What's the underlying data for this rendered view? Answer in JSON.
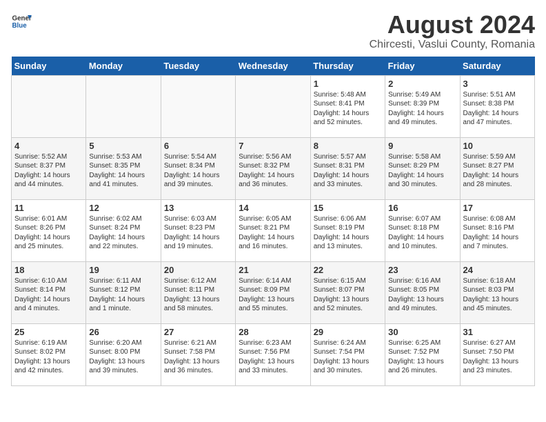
{
  "header": {
    "logo_general": "General",
    "logo_blue": "Blue",
    "title": "August 2024",
    "subtitle": "Chircesti, Vaslui County, Romania"
  },
  "days_of_week": [
    "Sunday",
    "Monday",
    "Tuesday",
    "Wednesday",
    "Thursday",
    "Friday",
    "Saturday"
  ],
  "weeks": [
    [
      {
        "day": "",
        "info": ""
      },
      {
        "day": "",
        "info": ""
      },
      {
        "day": "",
        "info": ""
      },
      {
        "day": "",
        "info": ""
      },
      {
        "day": "1",
        "info": "Sunrise: 5:48 AM\nSunset: 8:41 PM\nDaylight: 14 hours\nand 52 minutes."
      },
      {
        "day": "2",
        "info": "Sunrise: 5:49 AM\nSunset: 8:39 PM\nDaylight: 14 hours\nand 49 minutes."
      },
      {
        "day": "3",
        "info": "Sunrise: 5:51 AM\nSunset: 8:38 PM\nDaylight: 14 hours\nand 47 minutes."
      }
    ],
    [
      {
        "day": "4",
        "info": "Sunrise: 5:52 AM\nSunset: 8:37 PM\nDaylight: 14 hours\nand 44 minutes."
      },
      {
        "day": "5",
        "info": "Sunrise: 5:53 AM\nSunset: 8:35 PM\nDaylight: 14 hours\nand 41 minutes."
      },
      {
        "day": "6",
        "info": "Sunrise: 5:54 AM\nSunset: 8:34 PM\nDaylight: 14 hours\nand 39 minutes."
      },
      {
        "day": "7",
        "info": "Sunrise: 5:56 AM\nSunset: 8:32 PM\nDaylight: 14 hours\nand 36 minutes."
      },
      {
        "day": "8",
        "info": "Sunrise: 5:57 AM\nSunset: 8:31 PM\nDaylight: 14 hours\nand 33 minutes."
      },
      {
        "day": "9",
        "info": "Sunrise: 5:58 AM\nSunset: 8:29 PM\nDaylight: 14 hours\nand 30 minutes."
      },
      {
        "day": "10",
        "info": "Sunrise: 5:59 AM\nSunset: 8:27 PM\nDaylight: 14 hours\nand 28 minutes."
      }
    ],
    [
      {
        "day": "11",
        "info": "Sunrise: 6:01 AM\nSunset: 8:26 PM\nDaylight: 14 hours\nand 25 minutes."
      },
      {
        "day": "12",
        "info": "Sunrise: 6:02 AM\nSunset: 8:24 PM\nDaylight: 14 hours\nand 22 minutes."
      },
      {
        "day": "13",
        "info": "Sunrise: 6:03 AM\nSunset: 8:23 PM\nDaylight: 14 hours\nand 19 minutes."
      },
      {
        "day": "14",
        "info": "Sunrise: 6:05 AM\nSunset: 8:21 PM\nDaylight: 14 hours\nand 16 minutes."
      },
      {
        "day": "15",
        "info": "Sunrise: 6:06 AM\nSunset: 8:19 PM\nDaylight: 14 hours\nand 13 minutes."
      },
      {
        "day": "16",
        "info": "Sunrise: 6:07 AM\nSunset: 8:18 PM\nDaylight: 14 hours\nand 10 minutes."
      },
      {
        "day": "17",
        "info": "Sunrise: 6:08 AM\nSunset: 8:16 PM\nDaylight: 14 hours\nand 7 minutes."
      }
    ],
    [
      {
        "day": "18",
        "info": "Sunrise: 6:10 AM\nSunset: 8:14 PM\nDaylight: 14 hours\nand 4 minutes."
      },
      {
        "day": "19",
        "info": "Sunrise: 6:11 AM\nSunset: 8:12 PM\nDaylight: 14 hours\nand 1 minute."
      },
      {
        "day": "20",
        "info": "Sunrise: 6:12 AM\nSunset: 8:11 PM\nDaylight: 13 hours\nand 58 minutes."
      },
      {
        "day": "21",
        "info": "Sunrise: 6:14 AM\nSunset: 8:09 PM\nDaylight: 13 hours\nand 55 minutes."
      },
      {
        "day": "22",
        "info": "Sunrise: 6:15 AM\nSunset: 8:07 PM\nDaylight: 13 hours\nand 52 minutes."
      },
      {
        "day": "23",
        "info": "Sunrise: 6:16 AM\nSunset: 8:05 PM\nDaylight: 13 hours\nand 49 minutes."
      },
      {
        "day": "24",
        "info": "Sunrise: 6:18 AM\nSunset: 8:03 PM\nDaylight: 13 hours\nand 45 minutes."
      }
    ],
    [
      {
        "day": "25",
        "info": "Sunrise: 6:19 AM\nSunset: 8:02 PM\nDaylight: 13 hours\nand 42 minutes."
      },
      {
        "day": "26",
        "info": "Sunrise: 6:20 AM\nSunset: 8:00 PM\nDaylight: 13 hours\nand 39 minutes."
      },
      {
        "day": "27",
        "info": "Sunrise: 6:21 AM\nSunset: 7:58 PM\nDaylight: 13 hours\nand 36 minutes."
      },
      {
        "day": "28",
        "info": "Sunrise: 6:23 AM\nSunset: 7:56 PM\nDaylight: 13 hours\nand 33 minutes."
      },
      {
        "day": "29",
        "info": "Sunrise: 6:24 AM\nSunset: 7:54 PM\nDaylight: 13 hours\nand 30 minutes."
      },
      {
        "day": "30",
        "info": "Sunrise: 6:25 AM\nSunset: 7:52 PM\nDaylight: 13 hours\nand 26 minutes."
      },
      {
        "day": "31",
        "info": "Sunrise: 6:27 AM\nSunset: 7:50 PM\nDaylight: 13 hours\nand 23 minutes."
      }
    ]
  ]
}
